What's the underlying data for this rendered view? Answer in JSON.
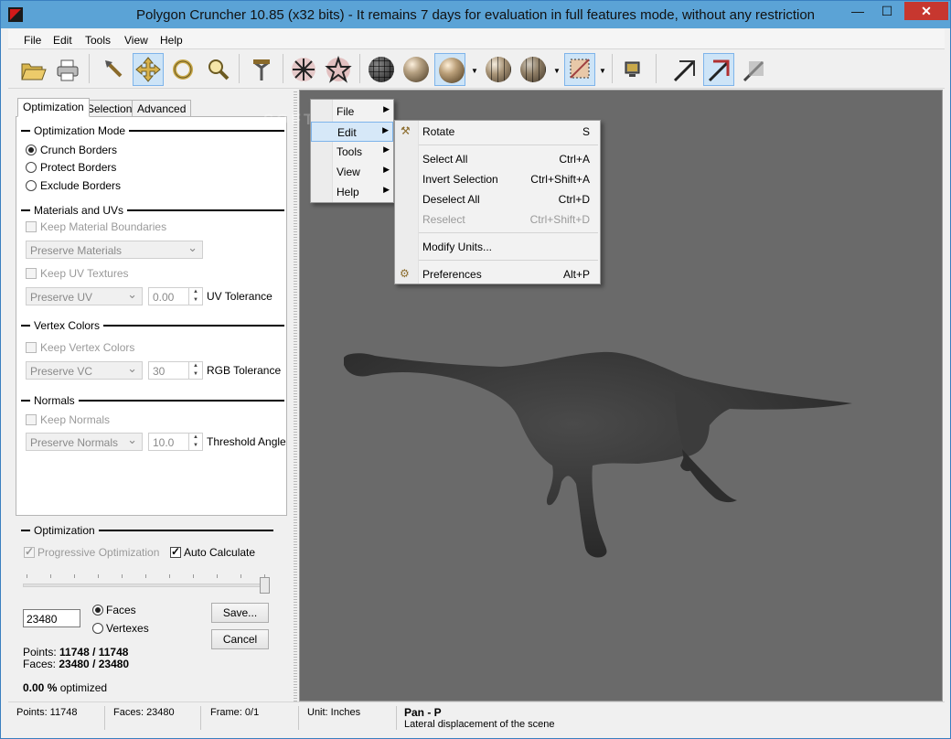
{
  "window": {
    "title": "Polygon Cruncher 10.85 (x32 bits) - It remains 7 days for evaluation in full features mode, without any restriction",
    "controls": {
      "minimize": "—",
      "maximize": "☐",
      "close": "✕"
    }
  },
  "menubar": {
    "items": [
      "File",
      "Edit",
      "Tools",
      "View",
      "Help"
    ]
  },
  "toolbar": {
    "buttons": [
      {
        "icon": "open-folder-icon"
      },
      {
        "icon": "print-icon"
      },
      {
        "icon": "select-arrow-icon"
      },
      {
        "icon": "pan-move-icon",
        "active": true
      },
      {
        "icon": "rotate-icon"
      },
      {
        "icon": "zoom-icon"
      },
      {
        "icon": "tools-hammer-icon"
      },
      {
        "icon": "cross-optimize-icon"
      },
      {
        "icon": "star-optimize-icon"
      },
      {
        "icon": "wireframe-sphere-icon"
      },
      {
        "icon": "flat-sphere-icon"
      },
      {
        "icon": "smooth-sphere-icon",
        "active": true
      },
      {
        "icon": "wire-smooth-sphere-icon"
      },
      {
        "icon": "mixed-sphere-icon"
      },
      {
        "icon": "texture-icon",
        "active": true
      },
      {
        "icon": "monitor-icon"
      },
      {
        "icon": "arrow-diag-icon"
      },
      {
        "icon": "arrow-diag-red-icon",
        "active": true
      },
      {
        "icon": "arrow-diag-gray-icon"
      }
    ]
  },
  "tabs": [
    "Optimization",
    "Selection",
    "Advanced"
  ],
  "optimization_mode": {
    "heading": "Optimization Mode",
    "options": [
      "Crunch Borders",
      "Protect Borders",
      "Exclude Borders"
    ],
    "selected": "Crunch Borders"
  },
  "materials": {
    "heading": "Materials and UVs",
    "keep_boundaries": "Keep Material Boundaries",
    "combo_materials": "Preserve Materials",
    "keep_uv": "Keep UV Textures",
    "combo_uv": "Preserve UV",
    "uv_value": "0.00",
    "uv_label": "UV Tolerance"
  },
  "vertex_colors": {
    "heading": "Vertex Colors",
    "keep": "Keep Vertex Colors",
    "combo": "Preserve VC",
    "value": "30",
    "label": "RGB Tolerance"
  },
  "normals": {
    "heading": "Normals",
    "keep": "Keep Normals",
    "combo": "Preserve Normals",
    "value": "10.0",
    "label": "Threshold Angle"
  },
  "optimization": {
    "heading": "Optimization",
    "progressive": "Progressive Optimization",
    "auto_calc": "Auto Calculate",
    "slider_level": 1.0,
    "count_value": "23480",
    "faces": "Faces",
    "vertexes": "Vertexes",
    "selected_unit": "Faces",
    "save": "Save...",
    "cancel": "Cancel",
    "points_label": "Points:",
    "points_value": "11748 / 11748",
    "faces_label": "Faces:",
    "faces_value": "23480 / 23480",
    "percent_value": "0.00 %",
    "percent_label": "optimized"
  },
  "context_menu": {
    "items": [
      "File",
      "Edit",
      "Tools",
      "View",
      "Help"
    ],
    "highlighted": "Edit"
  },
  "edit_submenu": {
    "items": [
      {
        "label": "Rotate",
        "key": "S",
        "icon": "rotate-hammer-icon"
      },
      {
        "label": "Select All",
        "key": "Ctrl+A"
      },
      {
        "label": "Invert Selection",
        "key": "Ctrl+Shift+A"
      },
      {
        "label": "Deselect All",
        "key": "Ctrl+D"
      },
      {
        "label": "Reselect",
        "key": "Ctrl+Shift+D",
        "disabled": true
      },
      {
        "label": "Modify Units..."
      },
      {
        "label": "Preferences",
        "key": "Alt+P",
        "icon": "preferences-icon"
      }
    ]
  },
  "watermark": "SOFTPEDIA",
  "statusbar": {
    "points": "Points: 11748",
    "faces": "Faces: 23480",
    "frame": "Frame: 0/1",
    "unit": "Unit: Inches",
    "mode": "Pan - P",
    "hint": "Lateral displacement of the scene"
  },
  "colors": {
    "titlebar": "#5ba3d6",
    "viewport": "#6a6a6a",
    "model": "#3a3a3a",
    "close_button": "#c7372f"
  }
}
